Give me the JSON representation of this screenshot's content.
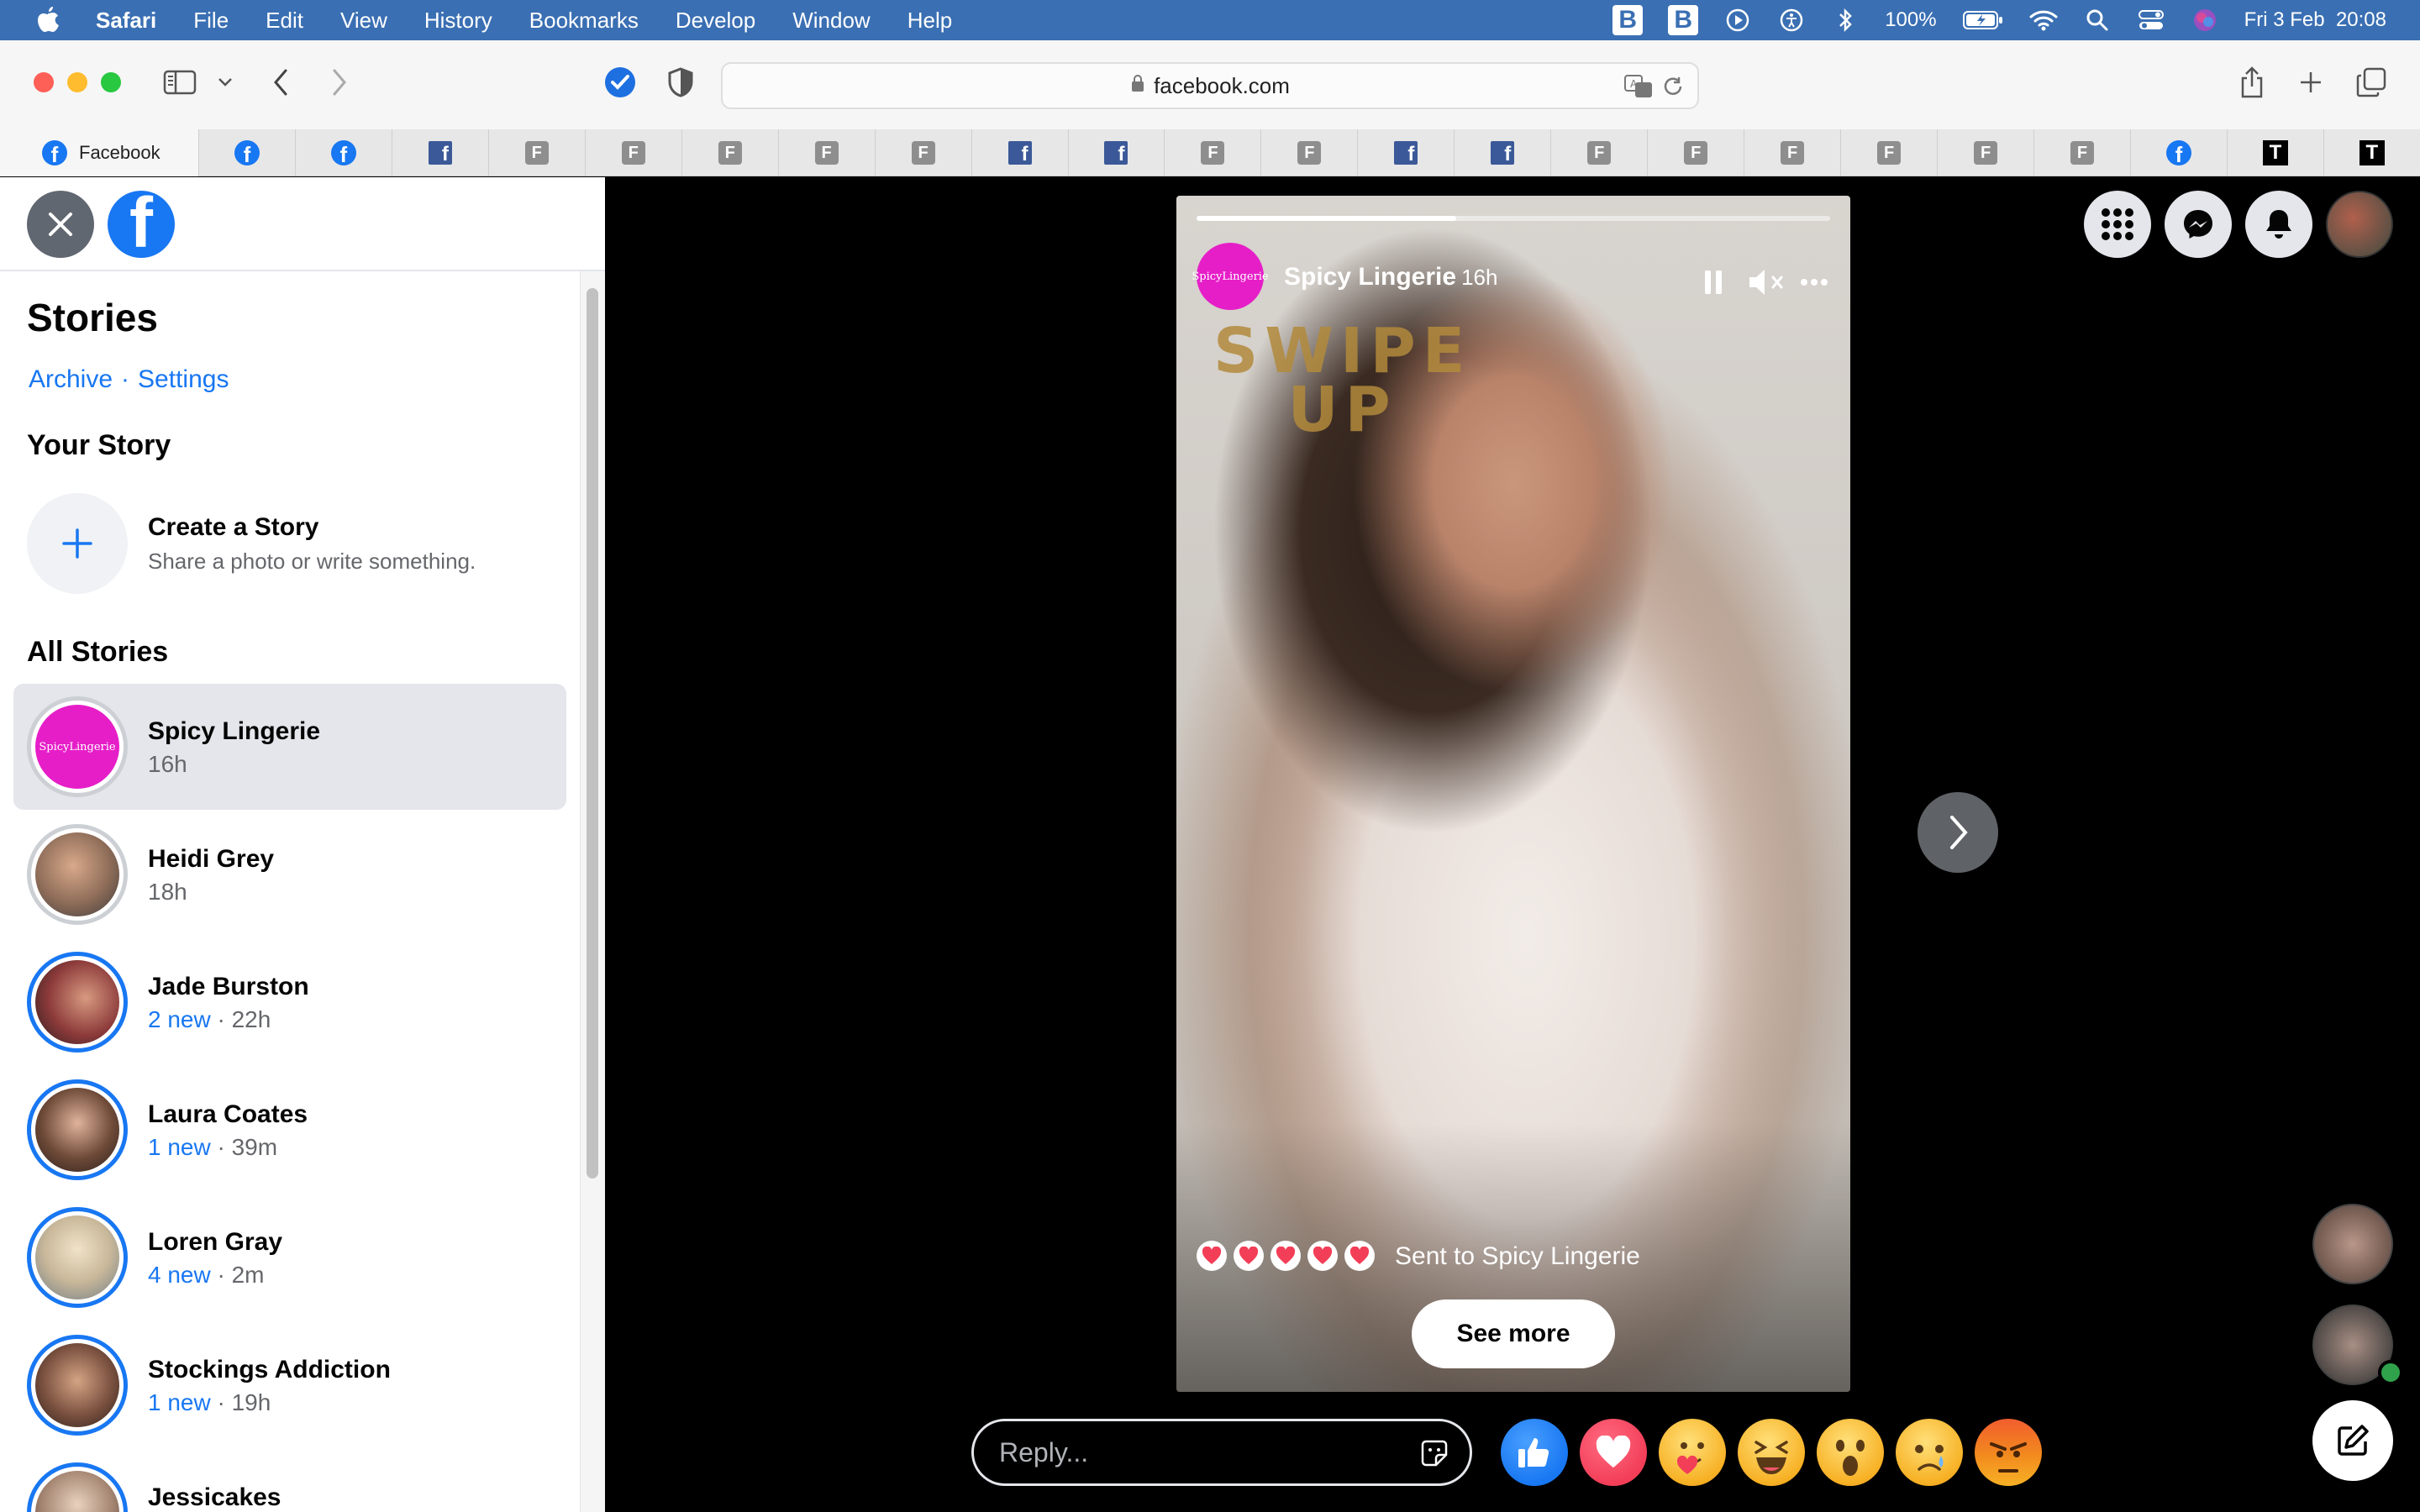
{
  "menubar": {
    "items": [
      "Safari",
      "File",
      "Edit",
      "View",
      "History",
      "Bookmarks",
      "Develop",
      "Window",
      "Help"
    ],
    "battery": "100%",
    "datetime": "Fri 3 Feb  20:08"
  },
  "browser": {
    "url": "facebook.com",
    "active_tab": "Facebook",
    "tab_glyphs": {
      "fb": "f",
      "grey": "F",
      "t": "T"
    }
  },
  "left": {
    "title": "Stories",
    "archive": "Archive",
    "link_sep": "·",
    "settings": "Settings",
    "your_story": "Your Story",
    "create_title": "Create a Story",
    "create_sub": "Share a photo or write something.",
    "all_stories": "All Stories",
    "stories": [
      {
        "name": "Spicy Lingerie",
        "new": "",
        "time": "16h"
      },
      {
        "name": "Heidi Grey",
        "new": "",
        "time": "18h"
      },
      {
        "name": "Jade Burston",
        "new": "2 new",
        "time": " · 22h"
      },
      {
        "name": "Laura Coates",
        "new": "1 new",
        "time": " · 39m"
      },
      {
        "name": "Loren Gray",
        "new": "4 new",
        "time": " · 2m"
      },
      {
        "name": "Stockings Addiction",
        "new": "1 new",
        "time": " · 19h"
      },
      {
        "name": "Jessicakes",
        "new": "",
        "time": ""
      }
    ]
  },
  "story": {
    "author": "Spicy Lingerie",
    "time": "16h",
    "avatar_text": "SpicyLingerie",
    "overlay_line1": "SWIPE",
    "overlay_line2": "UP",
    "progress": 0.41,
    "sent_text": "Sent to Spicy Lingerie",
    "see_more": "See more",
    "reply_placeholder": "Reply..."
  },
  "colors": {
    "fb_blue": "#1877f2",
    "menubar": "#3a6fb3",
    "magenta": "#e61ec8",
    "love_red": "#f33e58",
    "angry": "#e9710f"
  }
}
